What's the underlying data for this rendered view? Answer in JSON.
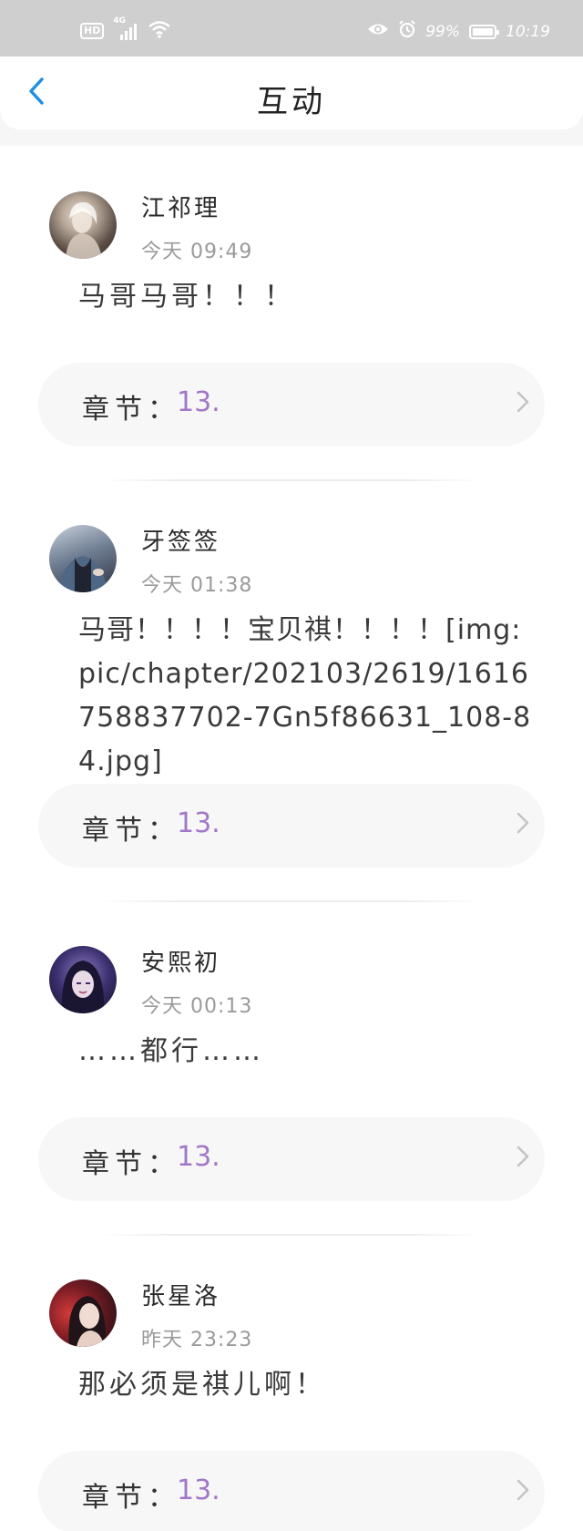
{
  "status_bar": {
    "hd_label": "HD",
    "network_label": "4G",
    "battery_text": "99%",
    "battery_level_percent": 99,
    "time": "10:19"
  },
  "header": {
    "title": "互动",
    "back_icon": "chevron-left-icon",
    "accent_color": "#1e8fe6"
  },
  "posts": [
    {
      "author": "江祁理",
      "time": "今天 09:49",
      "content": "马哥马哥！！！",
      "chapter_label": "章节：",
      "chapter_value": "13."
    },
    {
      "author": "牙签签",
      "time": "今天 01:38",
      "content": "马哥！！！！宝贝祺！！！！[img:pic/chapter/202103/2619/1616758837702-7Gn5f86631_108-84.jpg]",
      "chapter_label": "章节：",
      "chapter_value": "13."
    },
    {
      "author": "安熙初",
      "time": "今天 00:13",
      "content": "……都行……",
      "chapter_label": "章节：",
      "chapter_value": "13."
    },
    {
      "author": "张星洛",
      "time": "昨天 23:23",
      "content": "那必须是祺儿啊！",
      "chapter_label": "章节：",
      "chapter_value": "13."
    }
  ],
  "colors": {
    "chapter_value": "#a178c8",
    "status_bar_bg": "#cfcfcf"
  }
}
